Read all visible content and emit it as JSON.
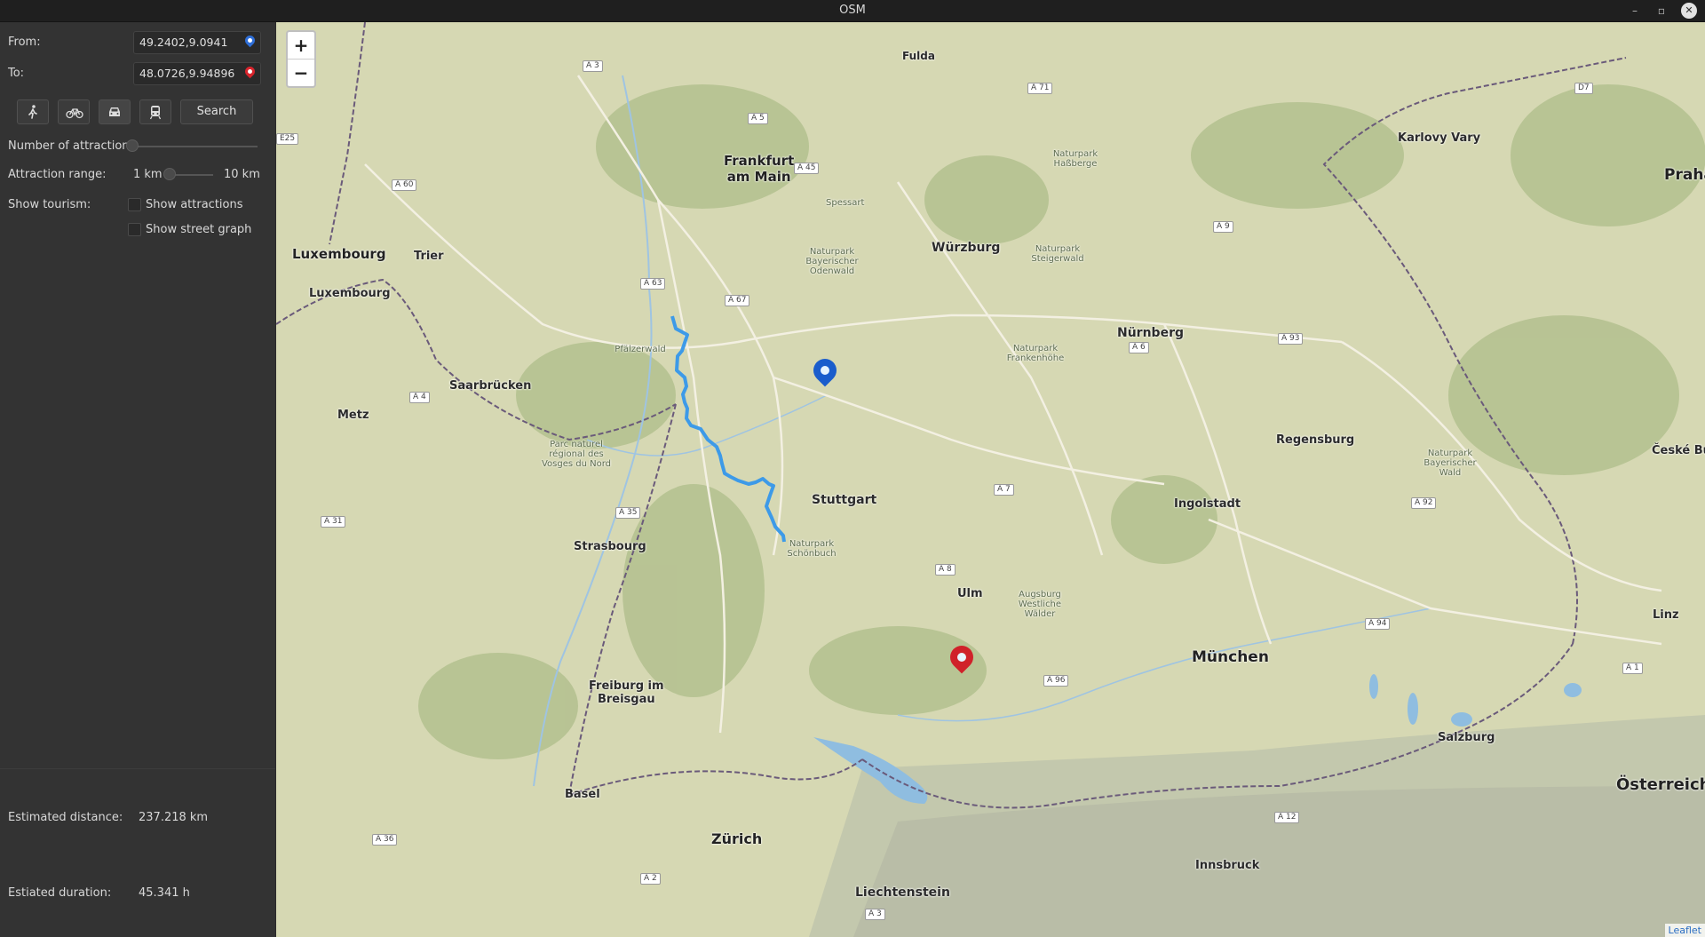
{
  "window": {
    "title": "OSM"
  },
  "form": {
    "from_label": "From:",
    "from_value": "49.2402,9.0941",
    "to_label": "To:",
    "to_value": "48.0726,9.94896",
    "transport_modes": [
      {
        "name": "walk",
        "icon": "walking-icon",
        "active": false
      },
      {
        "name": "bike",
        "icon": "bicycle-icon",
        "active": false
      },
      {
        "name": "car",
        "icon": "car-icon",
        "active": true
      },
      {
        "name": "transit",
        "icon": "train-icon",
        "active": false
      }
    ],
    "search_label": "Search",
    "attractions_label": "Number of attraction:",
    "range_label": "Attraction range:",
    "range_min": "1 km",
    "range_max": "10 km",
    "tourism_label": "Show tourism:",
    "show_attractions": "Show attractions",
    "show_street_graph": "Show street graph"
  },
  "results": {
    "distance_label": "Estimated distance:",
    "distance_value": "237.218 km",
    "duration_label": "Estiated duration:",
    "duration_value": "45.341 h"
  },
  "map": {
    "zoom_in": "+",
    "zoom_out": "−",
    "attribution": "Leaflet",
    "cities": {
      "frankfurt": "Frankfurt\nam Main",
      "stuttgart": "Stuttgart",
      "munchen": "München",
      "nurnberg": "Nürnberg",
      "wurzburg": "Würzburg",
      "luxembourg_country": "Luxembourg",
      "luxembourg_city": "Luxembourg",
      "strasbourg": "Strasbourg",
      "zurich": "Zürich",
      "basel": "Basel",
      "freiburg": "Freiburg im\nBreisgau",
      "ulm": "Ulm",
      "ingolstadt": "Ingolstadt",
      "regensburg": "Regensburg",
      "salzburg": "Salzburg",
      "innsbruck": "Innsbruck",
      "liechtenstein": "Liechtenstein",
      "osterreich": "Österreich",
      "praha": "Praha",
      "karlovy_vary": "Karlovy Vary",
      "linz": "Linz",
      "saarbrucken": "Saarbrücken",
      "metz": "Metz",
      "trier": "Trier",
      "fulda": "Fulda",
      "ceske_budejovice": "České Bude"
    },
    "parks": {
      "pfalzerwald": "Pfälzerwald",
      "odenwald": "Naturpark\nBayerischer\nOdenwald",
      "schonbuch": "Naturpark\nSchönbuch",
      "vosges": "Parc naturel\nrégional des\nVosges du Nord",
      "spessart": "Spessart",
      "frankenhohe": "Naturpark\nFrankenhöhe",
      "steigerwald": "Naturpark\nSteigerwald",
      "hassberge": "Naturpark\nHaßberge",
      "augsburg": "Augsburg\nWestliche\nWälder",
      "bayerischer_wald": "Naturpark\nBayerischer\nWald"
    },
    "roads": [
      "A 3",
      "A 5",
      "A 45",
      "A 7",
      "A 71",
      "A 9",
      "A 6",
      "A 63",
      "A 67",
      "A 60",
      "A 4",
      "A 8",
      "A 93",
      "A 92",
      "A 94",
      "A 96",
      "A 35",
      "A 31",
      "A 36",
      "A 12",
      "A 1",
      "A 2",
      "A 3",
      "E25",
      "D7"
    ]
  }
}
